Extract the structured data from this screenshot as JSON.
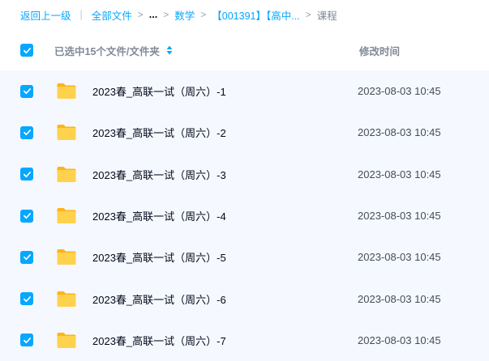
{
  "breadcrumb": {
    "back": "返回上一级",
    "root": "全部文件",
    "ellipsis": "...",
    "item_math": "数学",
    "item_course": "【001391】【高中...",
    "current": "课程"
  },
  "header": {
    "selection_label": "已选中15个文件/文件夹",
    "time_label": "修改时间"
  },
  "rows": [
    {
      "name": "2023春_高联一试（周六）-1",
      "time": "2023-08-03 10:45"
    },
    {
      "name": "2023春_高联一试（周六）-2",
      "time": "2023-08-03 10:45"
    },
    {
      "name": "2023春_高联一试（周六）-3",
      "time": "2023-08-03 10:45"
    },
    {
      "name": "2023春_高联一试（周六）-4",
      "time": "2023-08-03 10:45"
    },
    {
      "name": "2023春_高联一试（周六）-5",
      "time": "2023-08-03 10:45"
    },
    {
      "name": "2023春_高联一试（周六）-6",
      "time": "2023-08-03 10:45"
    },
    {
      "name": "2023春_高联一试（周六）-7",
      "time": "2023-08-03 10:45"
    }
  ],
  "colors": {
    "accent": "#06a7ff",
    "row_selected_bg": "#f5f8fe",
    "folder": "#ffc634"
  },
  "icons": {
    "checkbox": "check-icon",
    "folder": "folder-icon",
    "sort": "sort-icon"
  }
}
